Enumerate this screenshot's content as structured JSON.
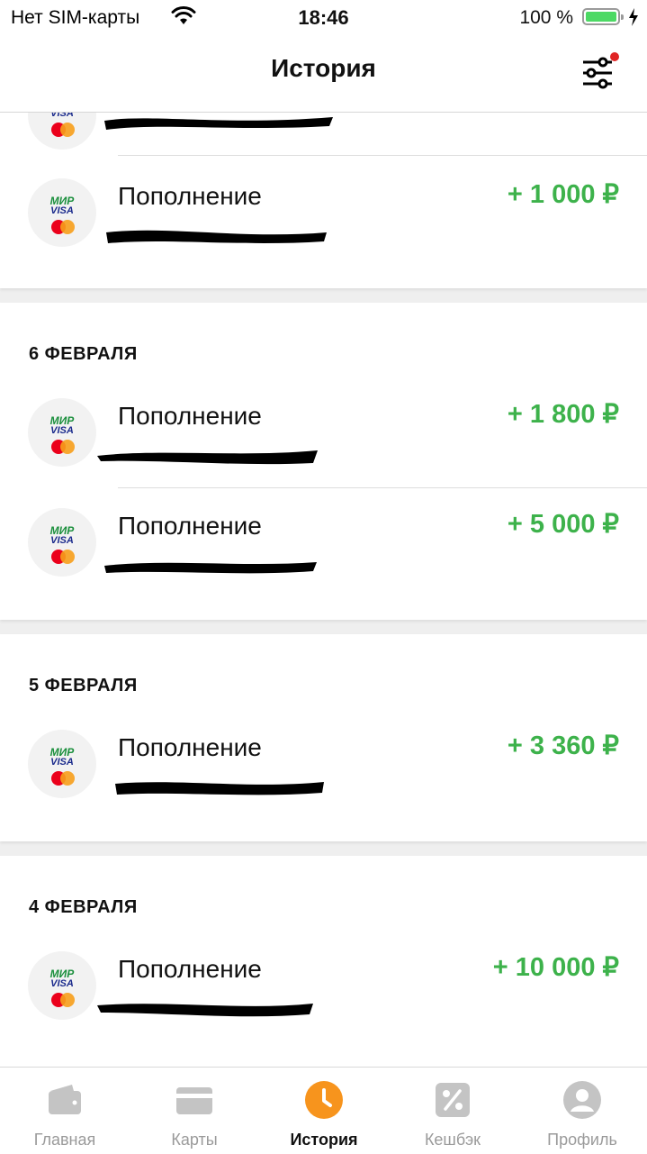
{
  "status_bar": {
    "carrier": "Нет SIM-карты",
    "time": "18:46",
    "battery": "100 %"
  },
  "header": {
    "title": "История"
  },
  "sections": [
    {
      "date": "",
      "items": [
        {
          "name": "",
          "amount": ""
        },
        {
          "name": "Пополнение",
          "amount": "+ 1 000 ₽"
        }
      ]
    },
    {
      "date": "6 ФЕВРАЛЯ",
      "items": [
        {
          "name": "Пополнение",
          "amount": "+ 1 800 ₽"
        },
        {
          "name": "Пополнение",
          "amount": "+ 5 000 ₽"
        }
      ]
    },
    {
      "date": "5 ФЕВРАЛЯ",
      "items": [
        {
          "name": "Пополнение",
          "amount": "+ 3 360 ₽"
        }
      ]
    },
    {
      "date": "4 ФЕВРАЛЯ",
      "items": [
        {
          "name": "Пополнение",
          "amount": "+ 10 000 ₽"
        }
      ]
    }
  ],
  "card_logo": {
    "mir": "МИР",
    "visa": "VISA"
  },
  "tabs": [
    {
      "label": "Главная",
      "icon": "wallet-icon"
    },
    {
      "label": "Карты",
      "icon": "card-icon"
    },
    {
      "label": "История",
      "icon": "clock-icon",
      "active": true
    },
    {
      "label": "Кешбэк",
      "icon": "percent-icon"
    },
    {
      "label": "Профиль",
      "icon": "profile-icon"
    }
  ],
  "colors": {
    "amount_positive": "#3db24b",
    "active_tab": "#f7941d",
    "inactive_tab": "#c4c4c4",
    "notification_dot": "#e02424"
  }
}
